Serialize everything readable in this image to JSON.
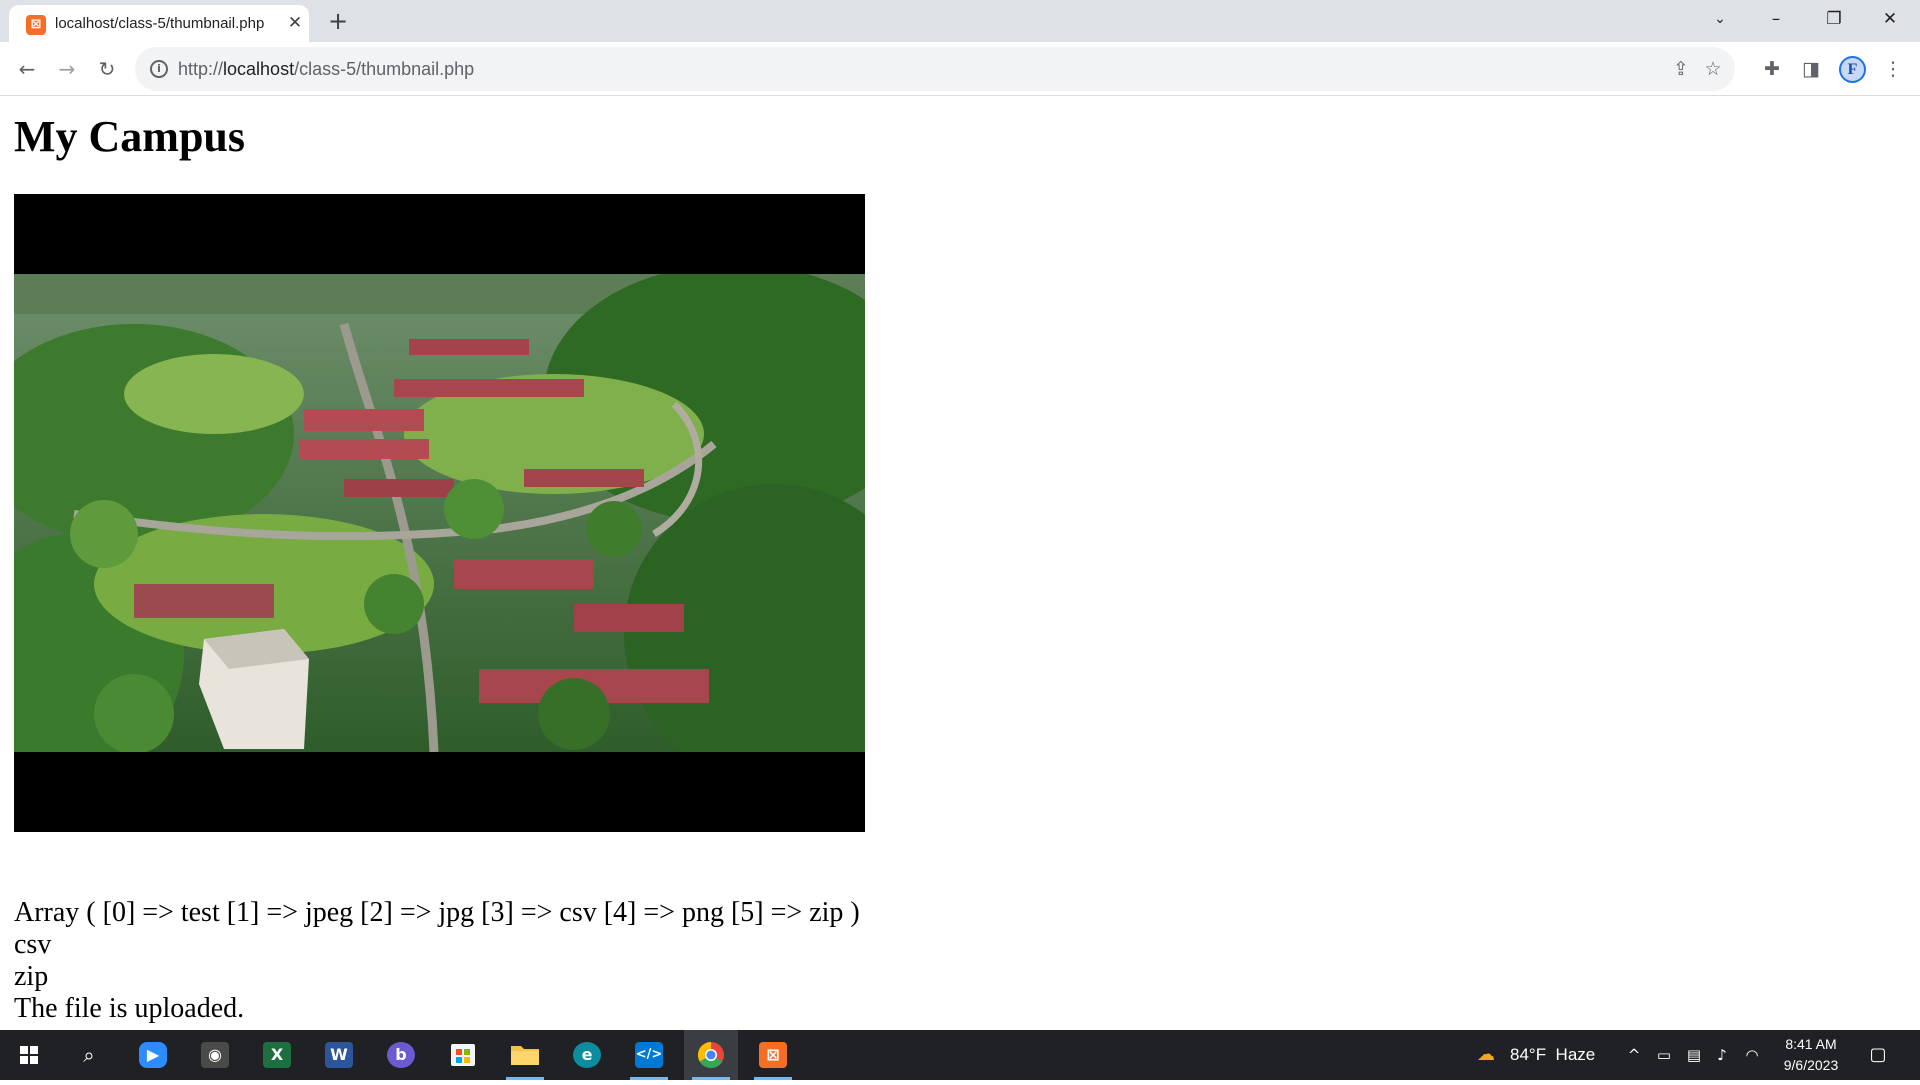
{
  "browser": {
    "tab_title": "localhost/class-5/thumbnail.php",
    "tab_favicon": "xampp-icon",
    "url_prefix": "http://",
    "url_host": "localhost",
    "url_path": "/class-5/thumbnail.php",
    "profile_initial": "F"
  },
  "page": {
    "title": "My Campus",
    "video_subject": "aerial view of campus buildings among green trees",
    "output_lines": [
      "Array ( [0] => test [1] => jpeg [2] => jpg [3] => csv [4] => png [5] => zip )",
      "csv",
      "zip",
      "The file is uploaded."
    ]
  },
  "taskbar": {
    "apps": [
      {
        "name": "zoom",
        "label": "Zoom",
        "color": "#2d8cff"
      },
      {
        "name": "camera",
        "label": "Camera",
        "color": "#4a4a4a"
      },
      {
        "name": "excel",
        "label": "X",
        "color": "#1d6f42"
      },
      {
        "name": "word",
        "label": "W",
        "color": "#2b579a"
      },
      {
        "name": "bing",
        "label": "b",
        "color": "#6b5bd2"
      },
      {
        "name": "store",
        "label": "Store",
        "color": "#f5f5f5"
      },
      {
        "name": "file-explorer",
        "label": "Files",
        "color": "#f2c14e"
      },
      {
        "name": "edge",
        "label": "e",
        "color": "#0c8c9e"
      },
      {
        "name": "vscode",
        "label": "VS",
        "color": "#0078d4"
      },
      {
        "name": "chrome",
        "label": "C",
        "color": "#e8453c"
      },
      {
        "name": "xampp",
        "label": "X",
        "color": "#f46f25"
      }
    ],
    "weather_temp": "84°F",
    "weather_text": "Haze",
    "time": "8:41 AM",
    "date": "9/6/2023"
  }
}
